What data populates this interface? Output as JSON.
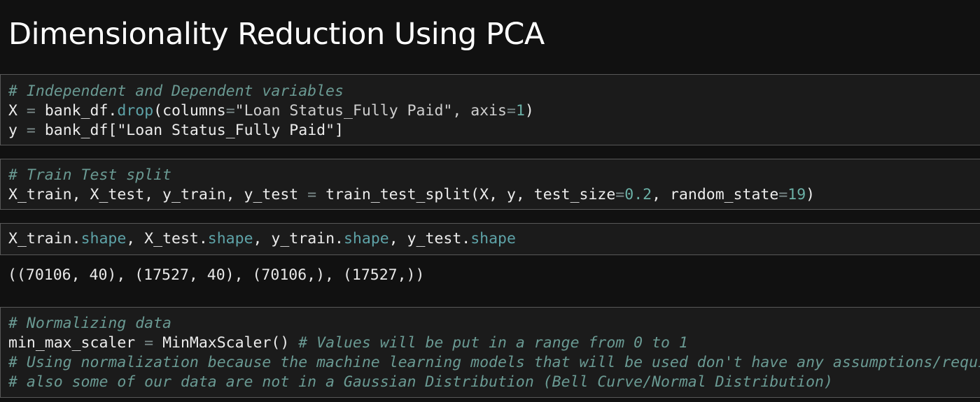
{
  "heading": "Dimensionality Reduction Using PCA",
  "cells": {
    "cell1": {
      "comment": "# Independent and Dependent variables",
      "line2": {
        "var": "X",
        "eq": "=",
        "obj": "bank_df.",
        "method": "drop",
        "args_a": "(columns",
        "eq2": "=",
        "args_b": "\"Loan Status_Fully Paid\", axis",
        "eq3": "=",
        "num": "1",
        "close": ")"
      },
      "line3": {
        "var": "y",
        "eq": "=",
        "rest": "bank_df[\"Loan Status_Fully Paid\"]"
      }
    },
    "cell2": {
      "comment": "# Train Test split",
      "line2": {
        "lhs": "X_train, X_test, y_train, y_test",
        "eq": "=",
        "call": "train_test_split(X, y, test_size",
        "eq2": "=",
        "num1": "0.2",
        "mid": ", random_state",
        "eq3": "=",
        "num2": "19",
        "close": ")"
      }
    },
    "cell3": {
      "a": "X_train.",
      "a_attr": "shape",
      "b": ", X_test.",
      "b_attr": "shape",
      "c": ", y_train.",
      "c_attr": "shape",
      "d": ", y_test.",
      "d_attr": "shape"
    },
    "cell3_output": "((70106, 40), (17527, 40), (70106,), (17527,))",
    "cell4": {
      "comment1": "# Normalizing data",
      "line2": {
        "var": "min_max_scaler",
        "eq": "=",
        "call": "MinMaxScaler()",
        "comment": "# Values will be put in a range from 0 to 1"
      },
      "comment3": "# Using normalization because the machine learning models that will be used don't have any assumptions/requi",
      "comment4": "# also some of our data are not in a Gaussian Distribution (Bell Curve/Normal Distribution)"
    }
  }
}
